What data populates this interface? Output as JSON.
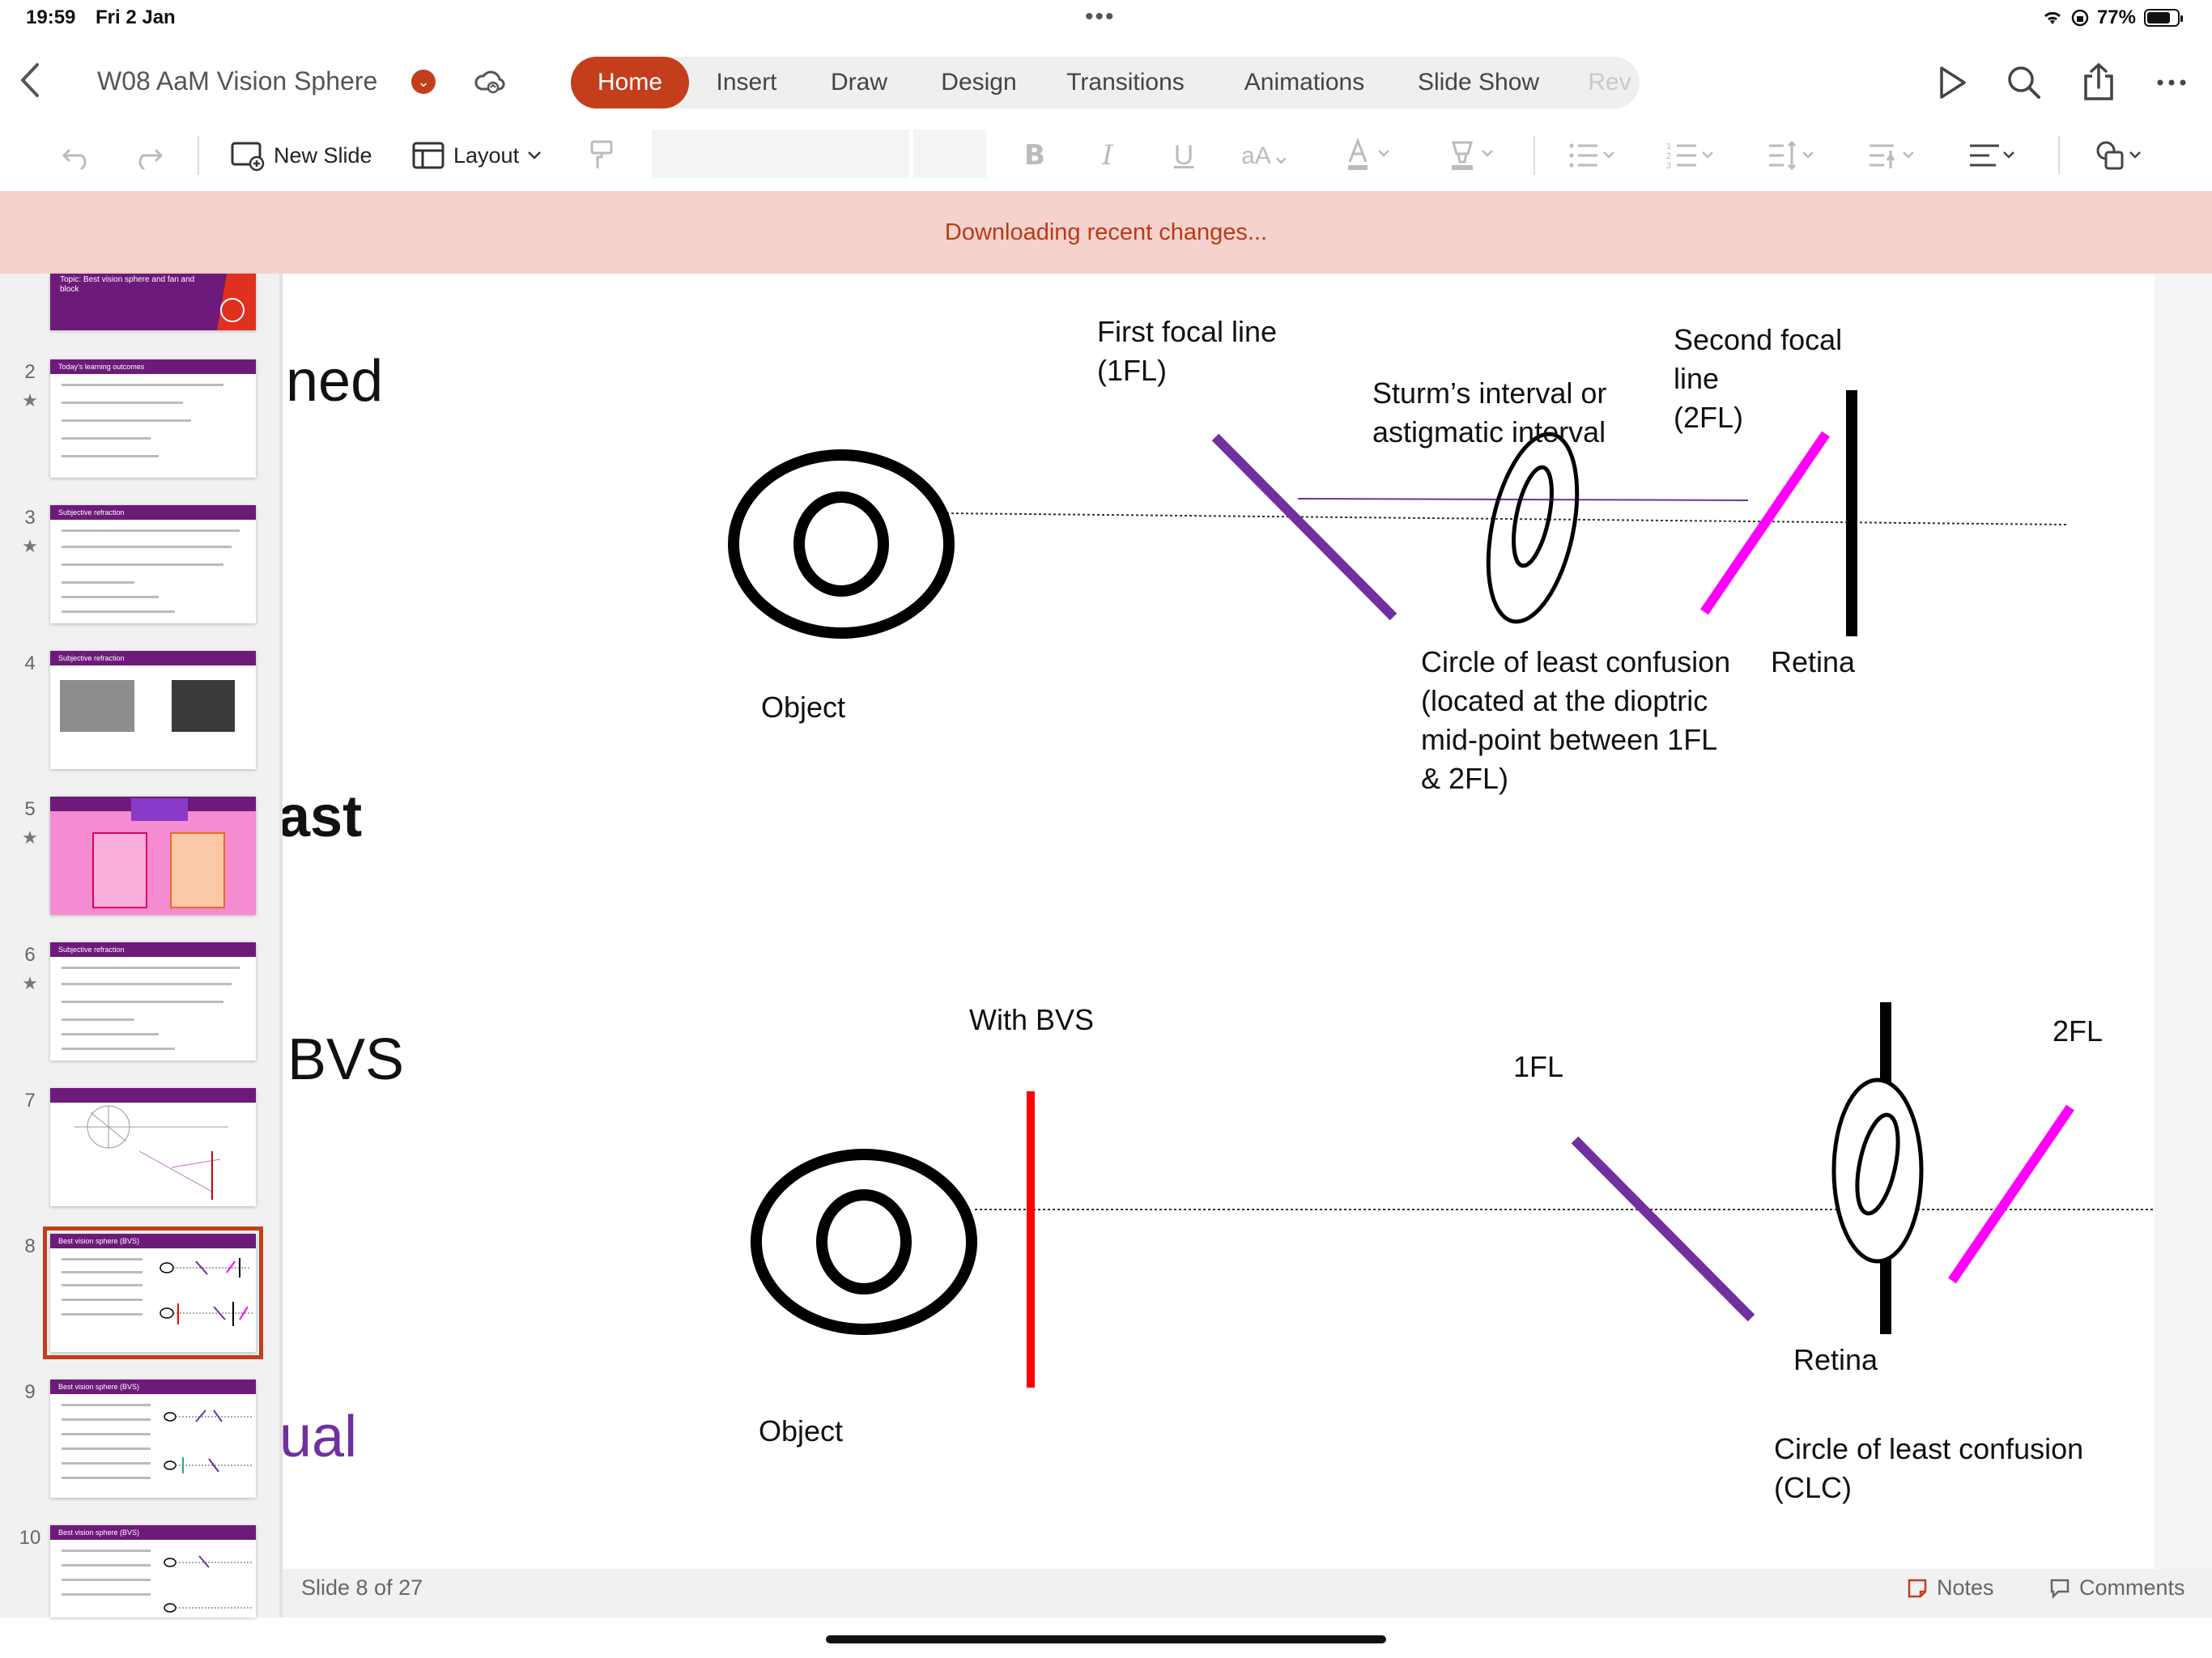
{
  "status": {
    "time": "19:59",
    "date": "Fri 2 Jan",
    "battery": "77%",
    "battery_level": 0.77
  },
  "document": {
    "title": "W08 AaM Vision Sphere"
  },
  "tabs": [
    {
      "label": "Home",
      "active": true
    },
    {
      "label": "Insert"
    },
    {
      "label": "Draw"
    },
    {
      "label": "Design"
    },
    {
      "label": "Transitions"
    },
    {
      "label": "Animations"
    },
    {
      "label": "Slide Show"
    },
    {
      "label": "Rev"
    }
  ],
  "toolbar": {
    "new_slide": "New Slide",
    "layout": "Layout"
  },
  "banner": {
    "text": "Downloading recent changes..."
  },
  "thumbnails": [
    {
      "number": "",
      "title": "Topic: Best vision sphere and fan and block",
      "starred": false
    },
    {
      "number": "2",
      "title": "Today's learning outcomes",
      "starred": true
    },
    {
      "number": "3",
      "title": "Subjective refraction",
      "starred": true
    },
    {
      "number": "4",
      "title": "Subjective refraction",
      "starred": false
    },
    {
      "number": "5",
      "title": "",
      "starred": true
    },
    {
      "number": "6",
      "title": "Subjective refraction",
      "starred": true
    },
    {
      "number": "7",
      "title": "",
      "starred": false
    },
    {
      "number": "8",
      "title": "Best vision sphere (BVS)",
      "starred": false,
      "selected": true
    },
    {
      "number": "9",
      "title": "Best vision sphere (BVS)",
      "starred": false
    },
    {
      "number": "10",
      "title": "Best vision sphere (BVS)",
      "starred": false
    }
  ],
  "slide": {
    "partial_text": [
      "ned",
      "ast",
      "BVS",
      "ual"
    ],
    "diagram_top": {
      "object_label": "Object",
      "first_focal_line": "First focal line\n(1FL)",
      "sturm_interval": "Sturm’s interval or\nastigmatic interval",
      "second_focal_line": "Second focal\nline\n(2FL)",
      "clc": "Circle of least confusion\n(located at the dioptric\nmid-point between 1FL\n& 2FL)",
      "retina": "Retina"
    },
    "diagram_bottom": {
      "with_bvs": "With BVS",
      "object_label": "Object",
      "fl1": "1FL",
      "fl2": "2FL",
      "retina": "Retina",
      "clc": "Circle of least confusion\n(CLC)"
    }
  },
  "footer": {
    "slide_count": "Slide 8 of 27",
    "notes": "Notes",
    "comments": "Comments"
  },
  "colors": {
    "accent": "#c43e1c",
    "banner_bg": "#f6d2cc",
    "purple_line": "#7030a0",
    "magenta_line": "#ff00ff",
    "red_line": "#ff0000",
    "thumb_header": "#6d1a7a"
  }
}
